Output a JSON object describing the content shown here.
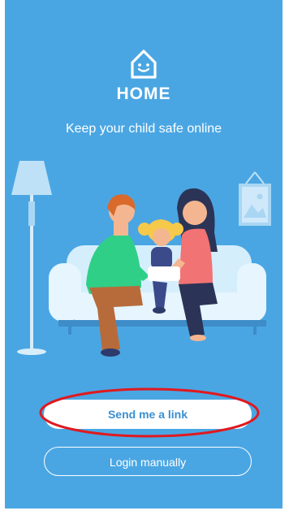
{
  "app": {
    "brand": "HOME",
    "tagline": "Keep your child safe online"
  },
  "actions": {
    "send_link_label": "Send me a link",
    "login_manual_label": "Login manually"
  },
  "colors": {
    "background": "#4aa6e3",
    "button_primary_bg": "#ffffff",
    "button_primary_text": "#3a8fd0",
    "highlight": "#e0191f"
  },
  "icons": {
    "logo": "house-smile-icon"
  }
}
